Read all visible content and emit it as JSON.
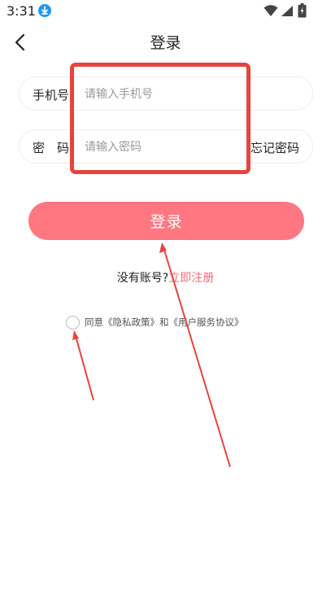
{
  "status_bar": {
    "time": "3:31",
    "icons": [
      "download-icon",
      "wifi-icon",
      "signal-icon",
      "battery-icon"
    ]
  },
  "header": {
    "title": "登录",
    "back_icon": "chevron-left-icon"
  },
  "form": {
    "phone_label": "手机号",
    "phone_placeholder": "请输入手机号",
    "password_label": "密码",
    "password_placeholder": "请输入密码",
    "forgot_label": "忘记密码"
  },
  "login_button_label": "登录",
  "register": {
    "prompt": "没有账号?",
    "link": "立即注册"
  },
  "agreement": {
    "text": "同意《隐私政策》和《用户服务协议》",
    "checked": false
  },
  "colors": {
    "primary": "#fe7781",
    "link": "#f56a75",
    "annotation": "#e8443a",
    "download_badge": "#2196f3"
  }
}
